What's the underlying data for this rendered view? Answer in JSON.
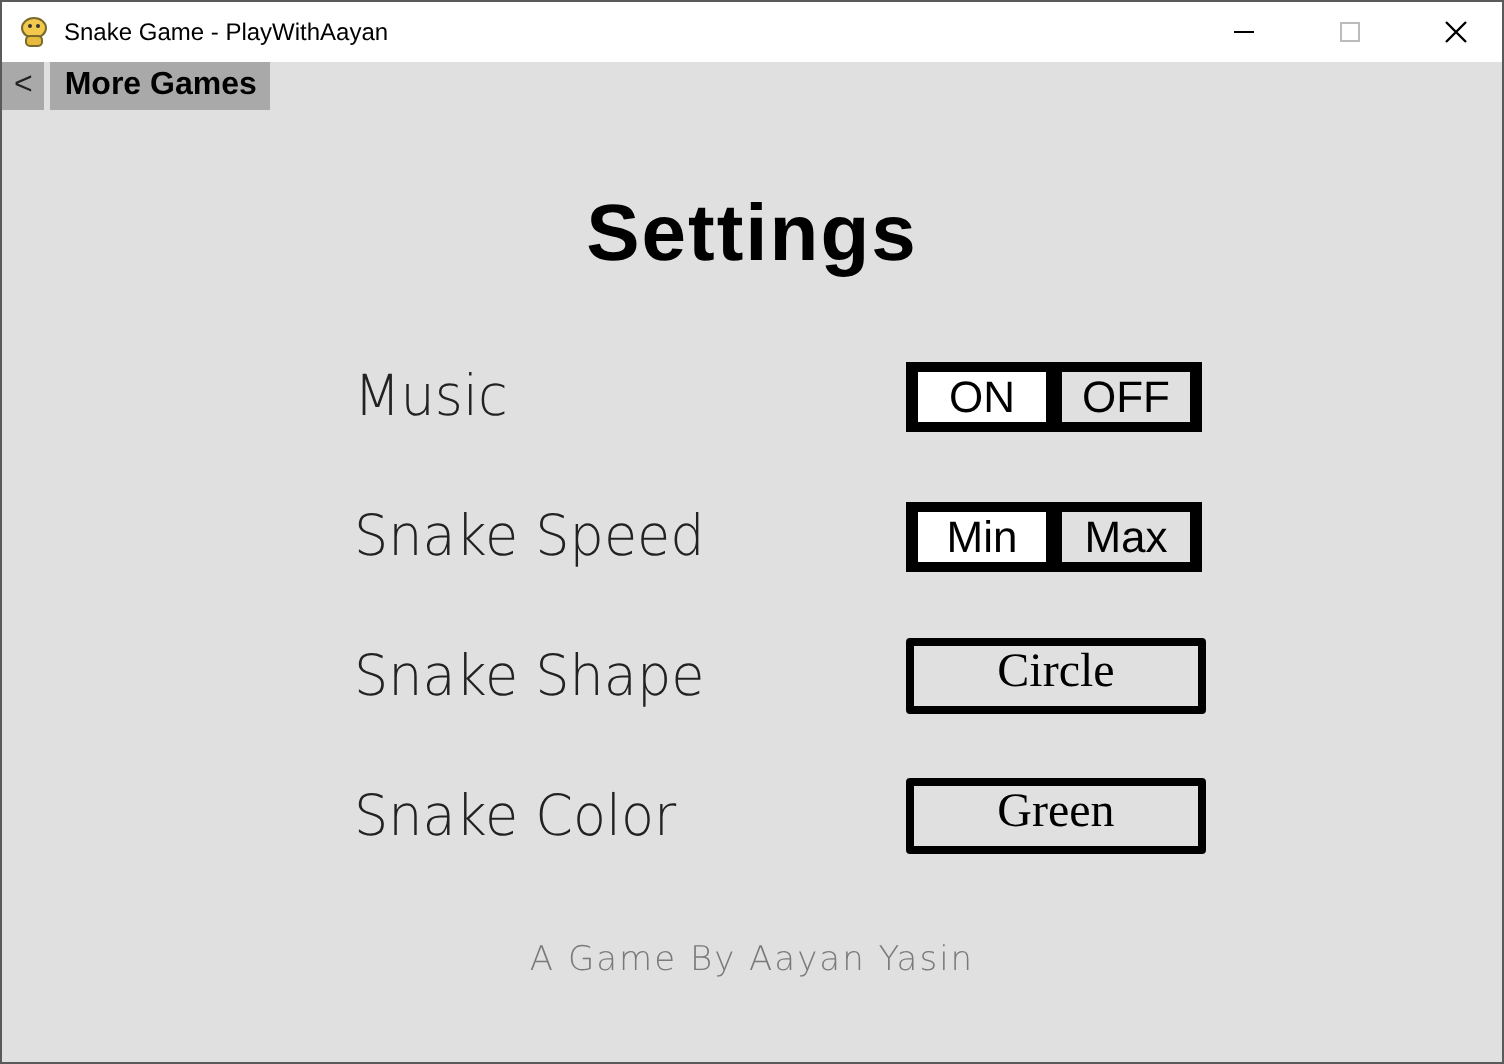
{
  "window": {
    "title": "Snake Game - PlayWithAayan"
  },
  "nav": {
    "back": "<",
    "more_games": "More Games"
  },
  "heading": "Settings",
  "settings": [
    {
      "label": "Music",
      "kind": "toggle",
      "options": [
        {
          "label": "ON",
          "selected": true
        },
        {
          "label": "OFF",
          "selected": false
        }
      ]
    },
    {
      "label": "Snake Speed",
      "kind": "toggle",
      "options": [
        {
          "label": "Min",
          "selected": true
        },
        {
          "label": "Max",
          "selected": false
        }
      ]
    },
    {
      "label": "Snake Shape",
      "kind": "cycle",
      "value": "Circle"
    },
    {
      "label": "Snake Color",
      "kind": "cycle",
      "value": "Green"
    }
  ],
  "footer": "A Game By Aayan Yasin"
}
